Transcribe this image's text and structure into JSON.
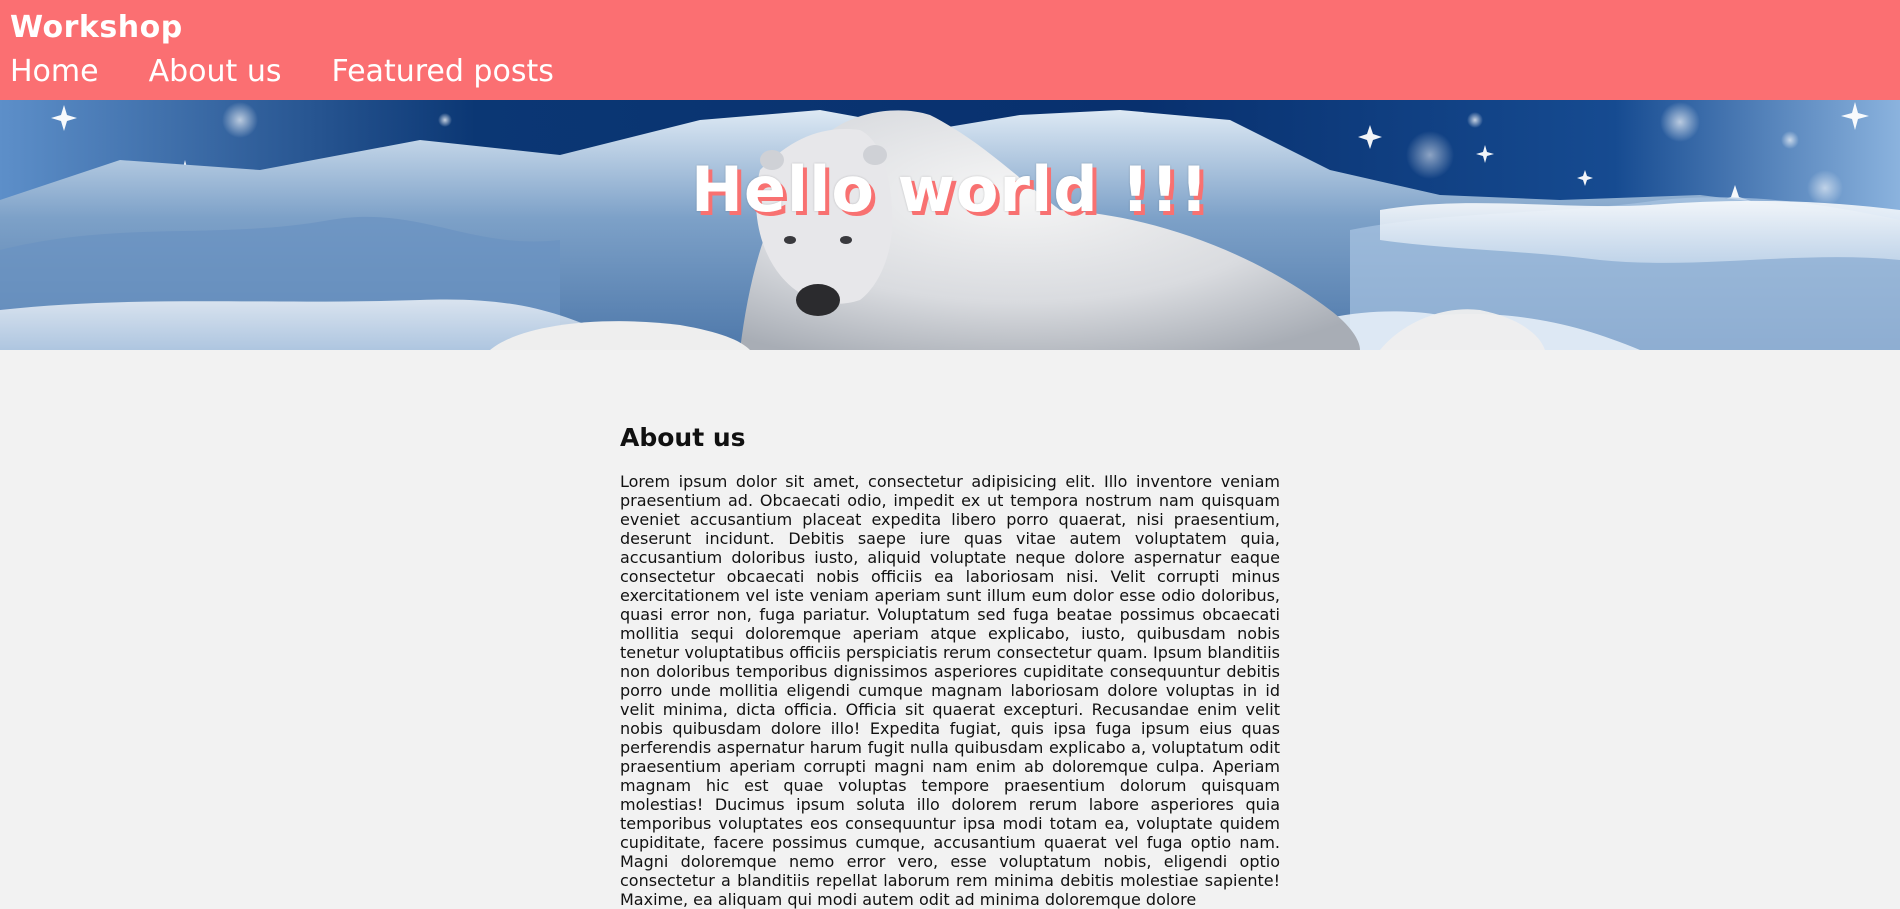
{
  "header": {
    "brand": "Workshop",
    "nav": [
      "Home",
      "About us",
      "Featured posts"
    ],
    "background": "#fb6f72"
  },
  "hero": {
    "title": "Hello world !!!",
    "image": "polar-bear-snow-mountain-banner"
  },
  "about": {
    "heading": "About us",
    "text": "Lorem ipsum dolor sit amet, consectetur adipisicing elit. Illo inventore veniam praesentium ad. Obcaecati odio, impedit ex ut tempora nostrum nam quisquam eveniet accusantium placeat expedita libero porro quaerat, nisi praesentium, deserunt incidunt. Debitis saepe iure quas vitae autem voluptatem quia, accusantium doloribus iusto, aliquid voluptate neque dolore aspernatur eaque consectetur obcaecati nobis officiis ea laboriosam nisi. Velit corrupti minus exercitationem vel iste veniam aperiam sunt illum eum dolor esse odio doloribus, quasi error non, fuga pariatur. Voluptatum sed fuga beatae possimus obcaecati mollitia sequi doloremque aperiam atque explicabo, iusto, quibusdam nobis tenetur voluptatibus officiis perspiciatis rerum consectetur quam. Ipsum blanditiis non doloribus temporibus dignissimos asperiores cupiditate consequuntur debitis porro unde mollitia eligendi cumque magnam laboriosam dolore voluptas in id velit minima, dicta officia. Officia sit quaerat excepturi. Recusandae enim velit nobis quibusdam dolore illo! Expedita fugiat, quis ipsa fuga ipsum eius quas perferendis aspernatur harum fugit nulla quibusdam explicabo a, voluptatum odit praesentium aperiam corrupti magni nam enim ab doloremque culpa. Aperiam magnam hic est quae voluptas tempore praesentium dolorum quisquam molestias! Ducimus ipsum soluta illo dolorem rerum labore asperiores quia temporibus voluptates eos consequuntur ipsa modi totam ea, voluptate quidem cupiditate, facere possimus cumque, accusantium quaerat vel fuga optio nam. Magni doloremque nemo error vero, esse voluptatum nobis, eligendi optio consectetur a blanditiis repellat laborum rem minima debitis molestiae sapiente! Maxime, ea aliquam qui modi autem odit ad minima doloremque dolore"
  }
}
